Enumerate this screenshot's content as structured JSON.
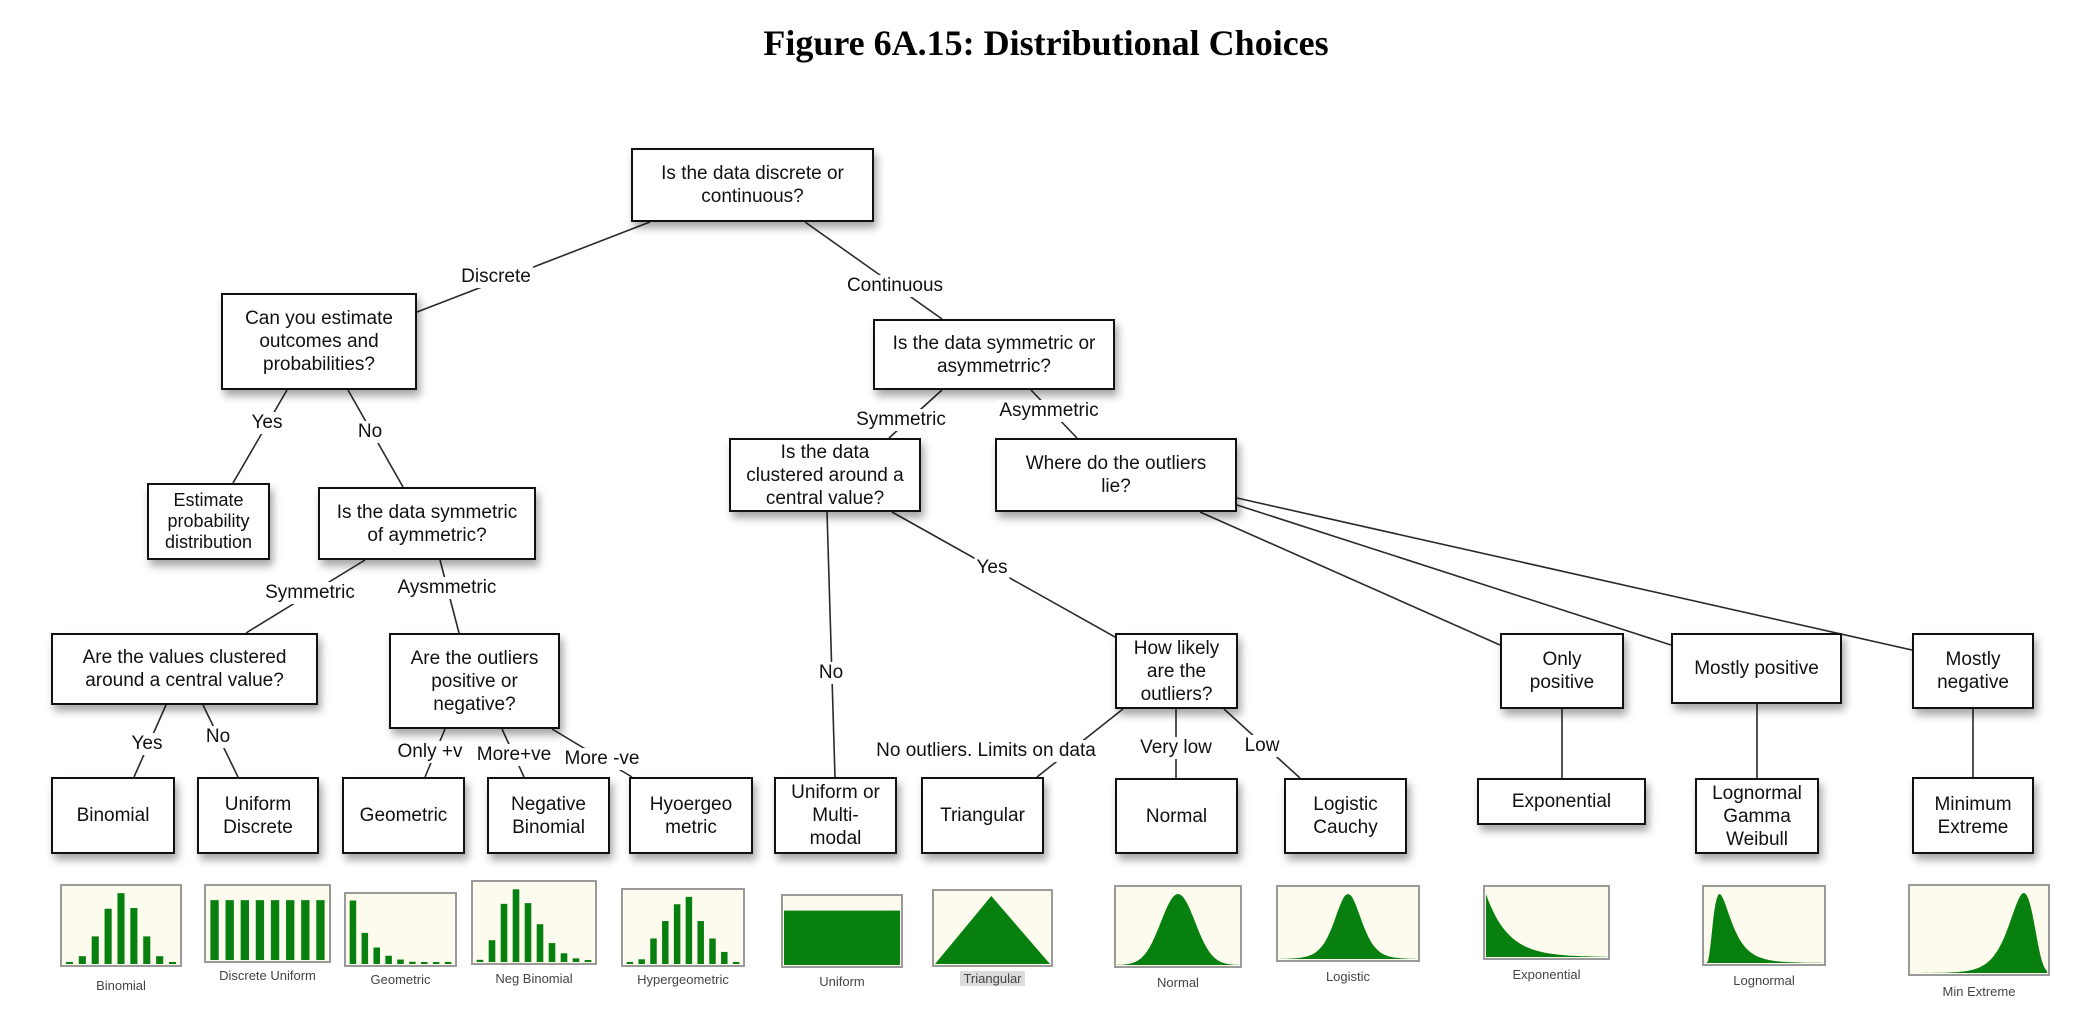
{
  "title": "Figure 6A.15: Distributional Choices",
  "colors": {
    "node_border": "#111111",
    "edge": "#2a2a2a",
    "thumb_bg": "#fdfbee",
    "thumb_frame": "#9a9a9a",
    "thumb_fill": "#08800f"
  },
  "nodes": [
    {
      "id": "root",
      "text": "Is the data discrete or\ncontinuous?"
    },
    {
      "id": "estimate_q",
      "text": "Can you estimate\noutcomes and\nprobabilities?"
    },
    {
      "id": "estimate_prob",
      "text": "Estimate\nprobability\ndistribution"
    },
    {
      "id": "disc_sym_q",
      "text": "Is the data symmetric\nof aymmetric?"
    },
    {
      "id": "disc_cluster_q",
      "text": "Are the values clustered\naround a central value?"
    },
    {
      "id": "disc_outliers_q",
      "text": "Are the outliers\npositive or\nnegative?"
    },
    {
      "id": "binomial",
      "text": "Binomial"
    },
    {
      "id": "uniform_discrete",
      "text": "Uniform\nDiscrete"
    },
    {
      "id": "geometric",
      "text": "Geometric"
    },
    {
      "id": "neg_binomial",
      "text": "Negative\nBinomial"
    },
    {
      "id": "hypergeometric",
      "text": "Hyoergeo\nmetric"
    },
    {
      "id": "cont_sym_q",
      "text": "Is the data symmetric or\nasymmetrric?"
    },
    {
      "id": "cont_cluster_q",
      "text": "Is the data\nclustered around a\ncentral value?"
    },
    {
      "id": "outliers_lie_q",
      "text": "Where do the outliers\nlie?"
    },
    {
      "id": "outliers_likely_q",
      "text": "How likely\nare the\noutliers?"
    },
    {
      "id": "uniform_multimodal",
      "text": "Uniform or\nMulti-\nmodal"
    },
    {
      "id": "triangular",
      "text": "Triangular"
    },
    {
      "id": "normal",
      "text": "Normal"
    },
    {
      "id": "logistic_cauchy",
      "text": "Logistic\nCauchy"
    },
    {
      "id": "only_positive",
      "text": "Only\npositive"
    },
    {
      "id": "mostly_positive",
      "text": "Mostly positive"
    },
    {
      "id": "mostly_negative",
      "text": "Mostly\nnegative"
    },
    {
      "id": "exponential",
      "text": "Exponential"
    },
    {
      "id": "lognormal_gamma_weibull",
      "text": "Lognormal\nGamma\nWeibull"
    },
    {
      "id": "minimum_extreme",
      "text": "Minimum\nExtreme"
    }
  ],
  "edges": [
    {
      "from": "root",
      "to": "estimate_q",
      "label": "Discrete"
    },
    {
      "from": "root",
      "to": "cont_sym_q",
      "label": "Continuous"
    },
    {
      "from": "estimate_q",
      "to": "estimate_prob",
      "label": "Yes"
    },
    {
      "from": "estimate_q",
      "to": "disc_sym_q",
      "label": "No"
    },
    {
      "from": "disc_sym_q",
      "to": "disc_cluster_q",
      "label": "Symmetric"
    },
    {
      "from": "disc_sym_q",
      "to": "disc_outliers_q",
      "label": "Aysmmetric"
    },
    {
      "from": "disc_cluster_q",
      "to": "binomial",
      "label": "Yes"
    },
    {
      "from": "disc_cluster_q",
      "to": "uniform_discrete",
      "label": "No"
    },
    {
      "from": "disc_outliers_q",
      "to": "geometric",
      "label": "Only +v"
    },
    {
      "from": "disc_outliers_q",
      "to": "neg_binomial",
      "label": "More+ve"
    },
    {
      "from": "disc_outliers_q",
      "to": "hypergeometric",
      "label": "More -ve"
    },
    {
      "from": "cont_sym_q",
      "to": "cont_cluster_q",
      "label": "Symmetric"
    },
    {
      "from": "cont_sym_q",
      "to": "outliers_lie_q",
      "label": "Asymmetric"
    },
    {
      "from": "cont_cluster_q",
      "to": "uniform_multimodal",
      "label": "No"
    },
    {
      "from": "cont_cluster_q",
      "to": "outliers_likely_q",
      "label": "Yes"
    },
    {
      "from": "outliers_likely_q",
      "to": "triangular",
      "label": "No outliers. Limits on data"
    },
    {
      "from": "outliers_likely_q",
      "to": "normal",
      "label": "Very low"
    },
    {
      "from": "outliers_likely_q",
      "to": "logistic_cauchy",
      "label": "Low"
    },
    {
      "from": "outliers_lie_q",
      "to": "only_positive",
      "label": ""
    },
    {
      "from": "outliers_lie_q",
      "to": "mostly_positive",
      "label": ""
    },
    {
      "from": "outliers_lie_q",
      "to": "mostly_negative",
      "label": ""
    },
    {
      "from": "only_positive",
      "to": "exponential",
      "label": ""
    },
    {
      "from": "mostly_positive",
      "to": "lognormal_gamma_weibull",
      "label": ""
    },
    {
      "from": "mostly_negative",
      "to": "minimum_extreme",
      "label": ""
    }
  ],
  "thumbnails": [
    {
      "id": "binomial",
      "label": "Binomial",
      "kind": "bars",
      "values": [
        0.01,
        0.11,
        0.39,
        0.78,
        1.0,
        0.79,
        0.39,
        0.11,
        0.01
      ]
    },
    {
      "id": "discrete_uniform",
      "label": "Discrete Uniform",
      "kind": "bars",
      "values": [
        1,
        1,
        1,
        1,
        1,
        1,
        1,
        1
      ]
    },
    {
      "id": "geometric",
      "label": "Geometric",
      "kind": "bars",
      "values": [
        1.0,
        0.49,
        0.26,
        0.13,
        0.07,
        0.035,
        0.015,
        0.007,
        0.003
      ]
    },
    {
      "id": "neg_binomial",
      "label": "Neg Binomial",
      "kind": "bars",
      "values": [
        0.03,
        0.3,
        0.8,
        1.0,
        0.81,
        0.52,
        0.26,
        0.12,
        0.05,
        0.01
      ]
    },
    {
      "id": "hypergeometric",
      "label": "Hypergeometric",
      "kind": "bars",
      "values": [
        0.01,
        0.07,
        0.38,
        0.64,
        0.89,
        1.0,
        0.64,
        0.38,
        0.18,
        0.01
      ]
    },
    {
      "id": "uniform",
      "label": "Uniform",
      "kind": "uniform",
      "values": [
        0.8
      ]
    },
    {
      "id": "triangular",
      "label": "Triangular",
      "kind": "triangular",
      "highlighted": true
    },
    {
      "id": "normal",
      "label": "Normal",
      "kind": "normal"
    },
    {
      "id": "logistic",
      "label": "Logistic",
      "kind": "logistic"
    },
    {
      "id": "exponential",
      "label": "Exponential",
      "kind": "exponential"
    },
    {
      "id": "lognormal",
      "label": "Lognormal",
      "kind": "lognormal"
    },
    {
      "id": "min_extreme",
      "label": "Min Extreme",
      "kind": "minextreme"
    }
  ]
}
